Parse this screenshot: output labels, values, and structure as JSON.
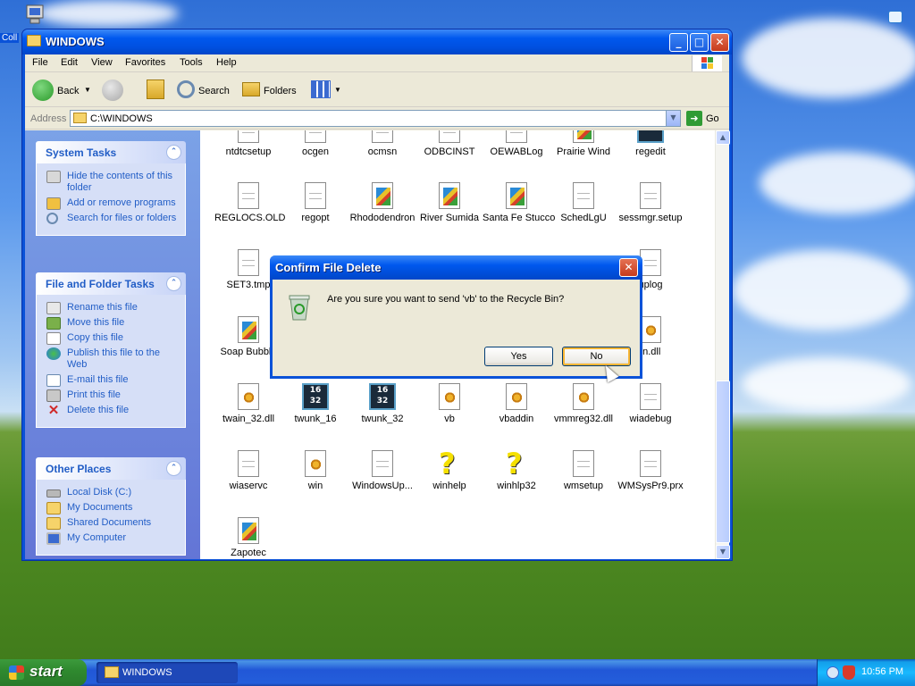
{
  "desktop": {
    "partial_label": "Coll"
  },
  "window": {
    "title": "WINDOWS",
    "menu": [
      "File",
      "Edit",
      "View",
      "Favorites",
      "Tools",
      "Help"
    ],
    "toolbar": {
      "back": "Back",
      "search": "Search",
      "folders": "Folders"
    },
    "address": {
      "label": "Address",
      "value": "C:\\WINDOWS",
      "go": "Go"
    }
  },
  "taskpane": {
    "system_tasks": {
      "title": "System Tasks",
      "items": [
        "Hide the contents of this folder",
        "Add or remove programs",
        "Search for files or folders"
      ]
    },
    "file_folder_tasks": {
      "title": "File and Folder Tasks",
      "items": [
        "Rename this file",
        "Move this file",
        "Copy this file",
        "Publish this file to the Web",
        "E-mail this file",
        "Print this file",
        "Delete this file"
      ]
    },
    "other_places": {
      "title": "Other Places",
      "items": [
        "Local Disk (C:)",
        "My Documents",
        "Shared Documents",
        "My Computer"
      ]
    }
  },
  "files": [
    {
      "name": "ntdtcsetup",
      "icon": "doc"
    },
    {
      "name": "ocgen",
      "icon": "doc"
    },
    {
      "name": "ocmsn",
      "icon": "doc"
    },
    {
      "name": "ODBCINST",
      "icon": "doc"
    },
    {
      "name": "OEWABLog",
      "icon": "doc"
    },
    {
      "name": "Prairie Wind",
      "icon": "pic"
    },
    {
      "name": "regedit",
      "icon": "exe"
    },
    {
      "name": "REGLOCS.OLD",
      "icon": "doc"
    },
    {
      "name": "regopt",
      "icon": "doc"
    },
    {
      "name": "Rhododendron",
      "icon": "pic"
    },
    {
      "name": "River Sumida",
      "icon": "pic"
    },
    {
      "name": "Santa Fe Stucco",
      "icon": "pic"
    },
    {
      "name": "SchedLgU",
      "icon": "doc"
    },
    {
      "name": "sessmgr.setup",
      "icon": "doc"
    },
    {
      "name": "SET3.tmp",
      "icon": "doc"
    },
    {
      "name": "uplog",
      "icon": "doc"
    },
    {
      "name": "Soap Bubble",
      "icon": "pic"
    },
    {
      "name": "in.dll",
      "icon": "dll"
    },
    {
      "name": "twain_32.dll",
      "icon": "dll"
    },
    {
      "name": "twunk_16",
      "icon": "exe",
      "exe_text": "16\n32"
    },
    {
      "name": "twunk_32",
      "icon": "exe",
      "exe_text": "16\n32"
    },
    {
      "name": "vb",
      "icon": "dll"
    },
    {
      "name": "vbaddin",
      "icon": "dll"
    },
    {
      "name": "vmmreg32.dll",
      "icon": "dll"
    },
    {
      "name": "wiadebug",
      "icon": "doc"
    },
    {
      "name": "wiaservc",
      "icon": "doc"
    },
    {
      "name": "win",
      "icon": "dll"
    },
    {
      "name": "WindowsUp...",
      "icon": "doc"
    },
    {
      "name": "winhelp",
      "icon": "help"
    },
    {
      "name": "winhlp32",
      "icon": "help"
    },
    {
      "name": "wmsetup",
      "icon": "doc"
    },
    {
      "name": "WMSysPr9.prx",
      "icon": "doc"
    },
    {
      "name": "Zapotec",
      "icon": "pic"
    }
  ],
  "dialog": {
    "title": "Confirm File Delete",
    "message": "Are you sure you want to send 'vb' to the Recycle Bin?",
    "yes": "Yes",
    "no": "No"
  },
  "taskbar": {
    "start": "start",
    "window_button": "WINDOWS",
    "clock": "10:56 PM"
  },
  "colors": {
    "accent": "#0a52d8",
    "link": "#215dc6",
    "start_green": "#2f8a2f"
  }
}
